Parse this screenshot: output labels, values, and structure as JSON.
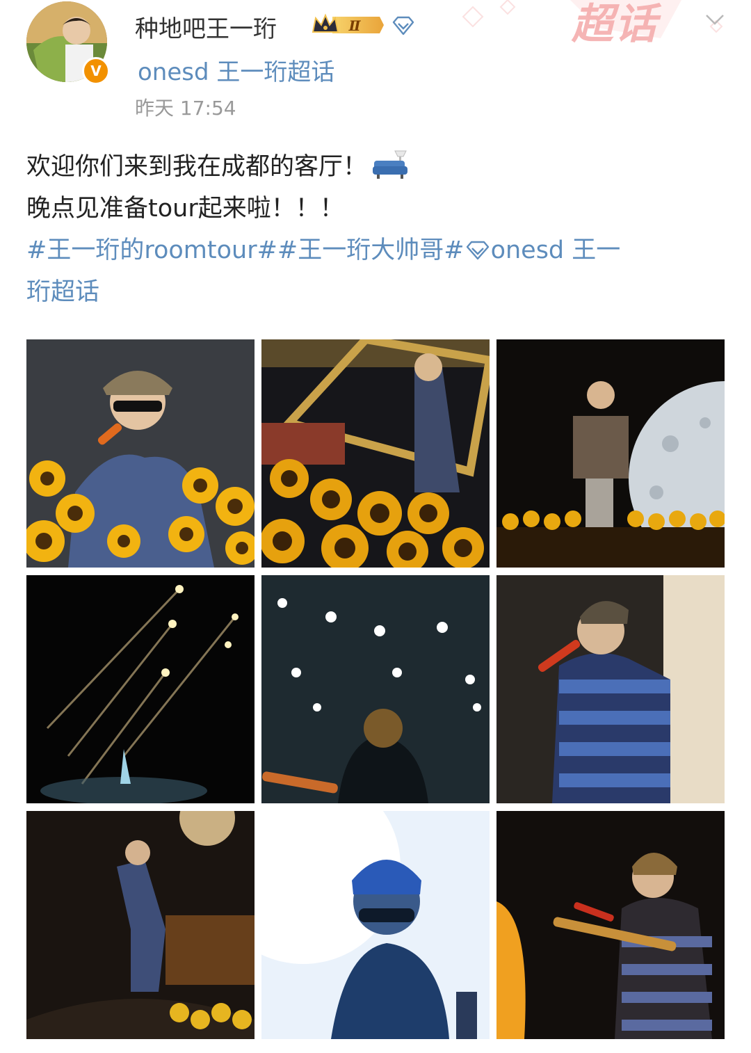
{
  "post": {
    "username": "种地吧王一珩",
    "vip_level": "Ⅱ",
    "verified_mark": "V",
    "source": "onesd 王一珩超话",
    "timestamp": "昨天 17:54",
    "watermark_label": "超话"
  },
  "content": {
    "line1": "欢迎你们来到我在成都的客厅！",
    "line2": "晚点见准备tour起来啦！！！",
    "tags_part1": "#王一珩的roomtour##王一珩大帅哥#",
    "tags_part2": "onesd 王一",
    "tags_part3": "珩超话"
  },
  "icons": {
    "sofa": "sofa-emoji-icon",
    "diamond": "supertopic-diamond-icon",
    "crown": "crown-vip-badge-icon",
    "chevron": "chevron-down-icon"
  },
  "colors": {
    "link": "#5d8cbc",
    "text": "#222222",
    "meta": "#999999",
    "badge": "#f29100"
  },
  "photos": [
    {
      "label": "photo 1",
      "scene": "seated-sunflowers"
    },
    {
      "label": "photo 2",
      "scene": "stage-frame-sunflowers"
    },
    {
      "label": "photo 3",
      "scene": "moon-stage"
    },
    {
      "label": "photo 4",
      "scene": "light-beams"
    },
    {
      "label": "photo 5",
      "scene": "arena-lights-guitar"
    },
    {
      "label": "photo 6",
      "scene": "singing-striped-sweater"
    },
    {
      "label": "photo 7",
      "scene": "stage-wide-orange"
    },
    {
      "label": "photo 8",
      "scene": "bright-blue-closeup"
    },
    {
      "label": "photo 9",
      "scene": "guitar-dark-stage"
    }
  ]
}
